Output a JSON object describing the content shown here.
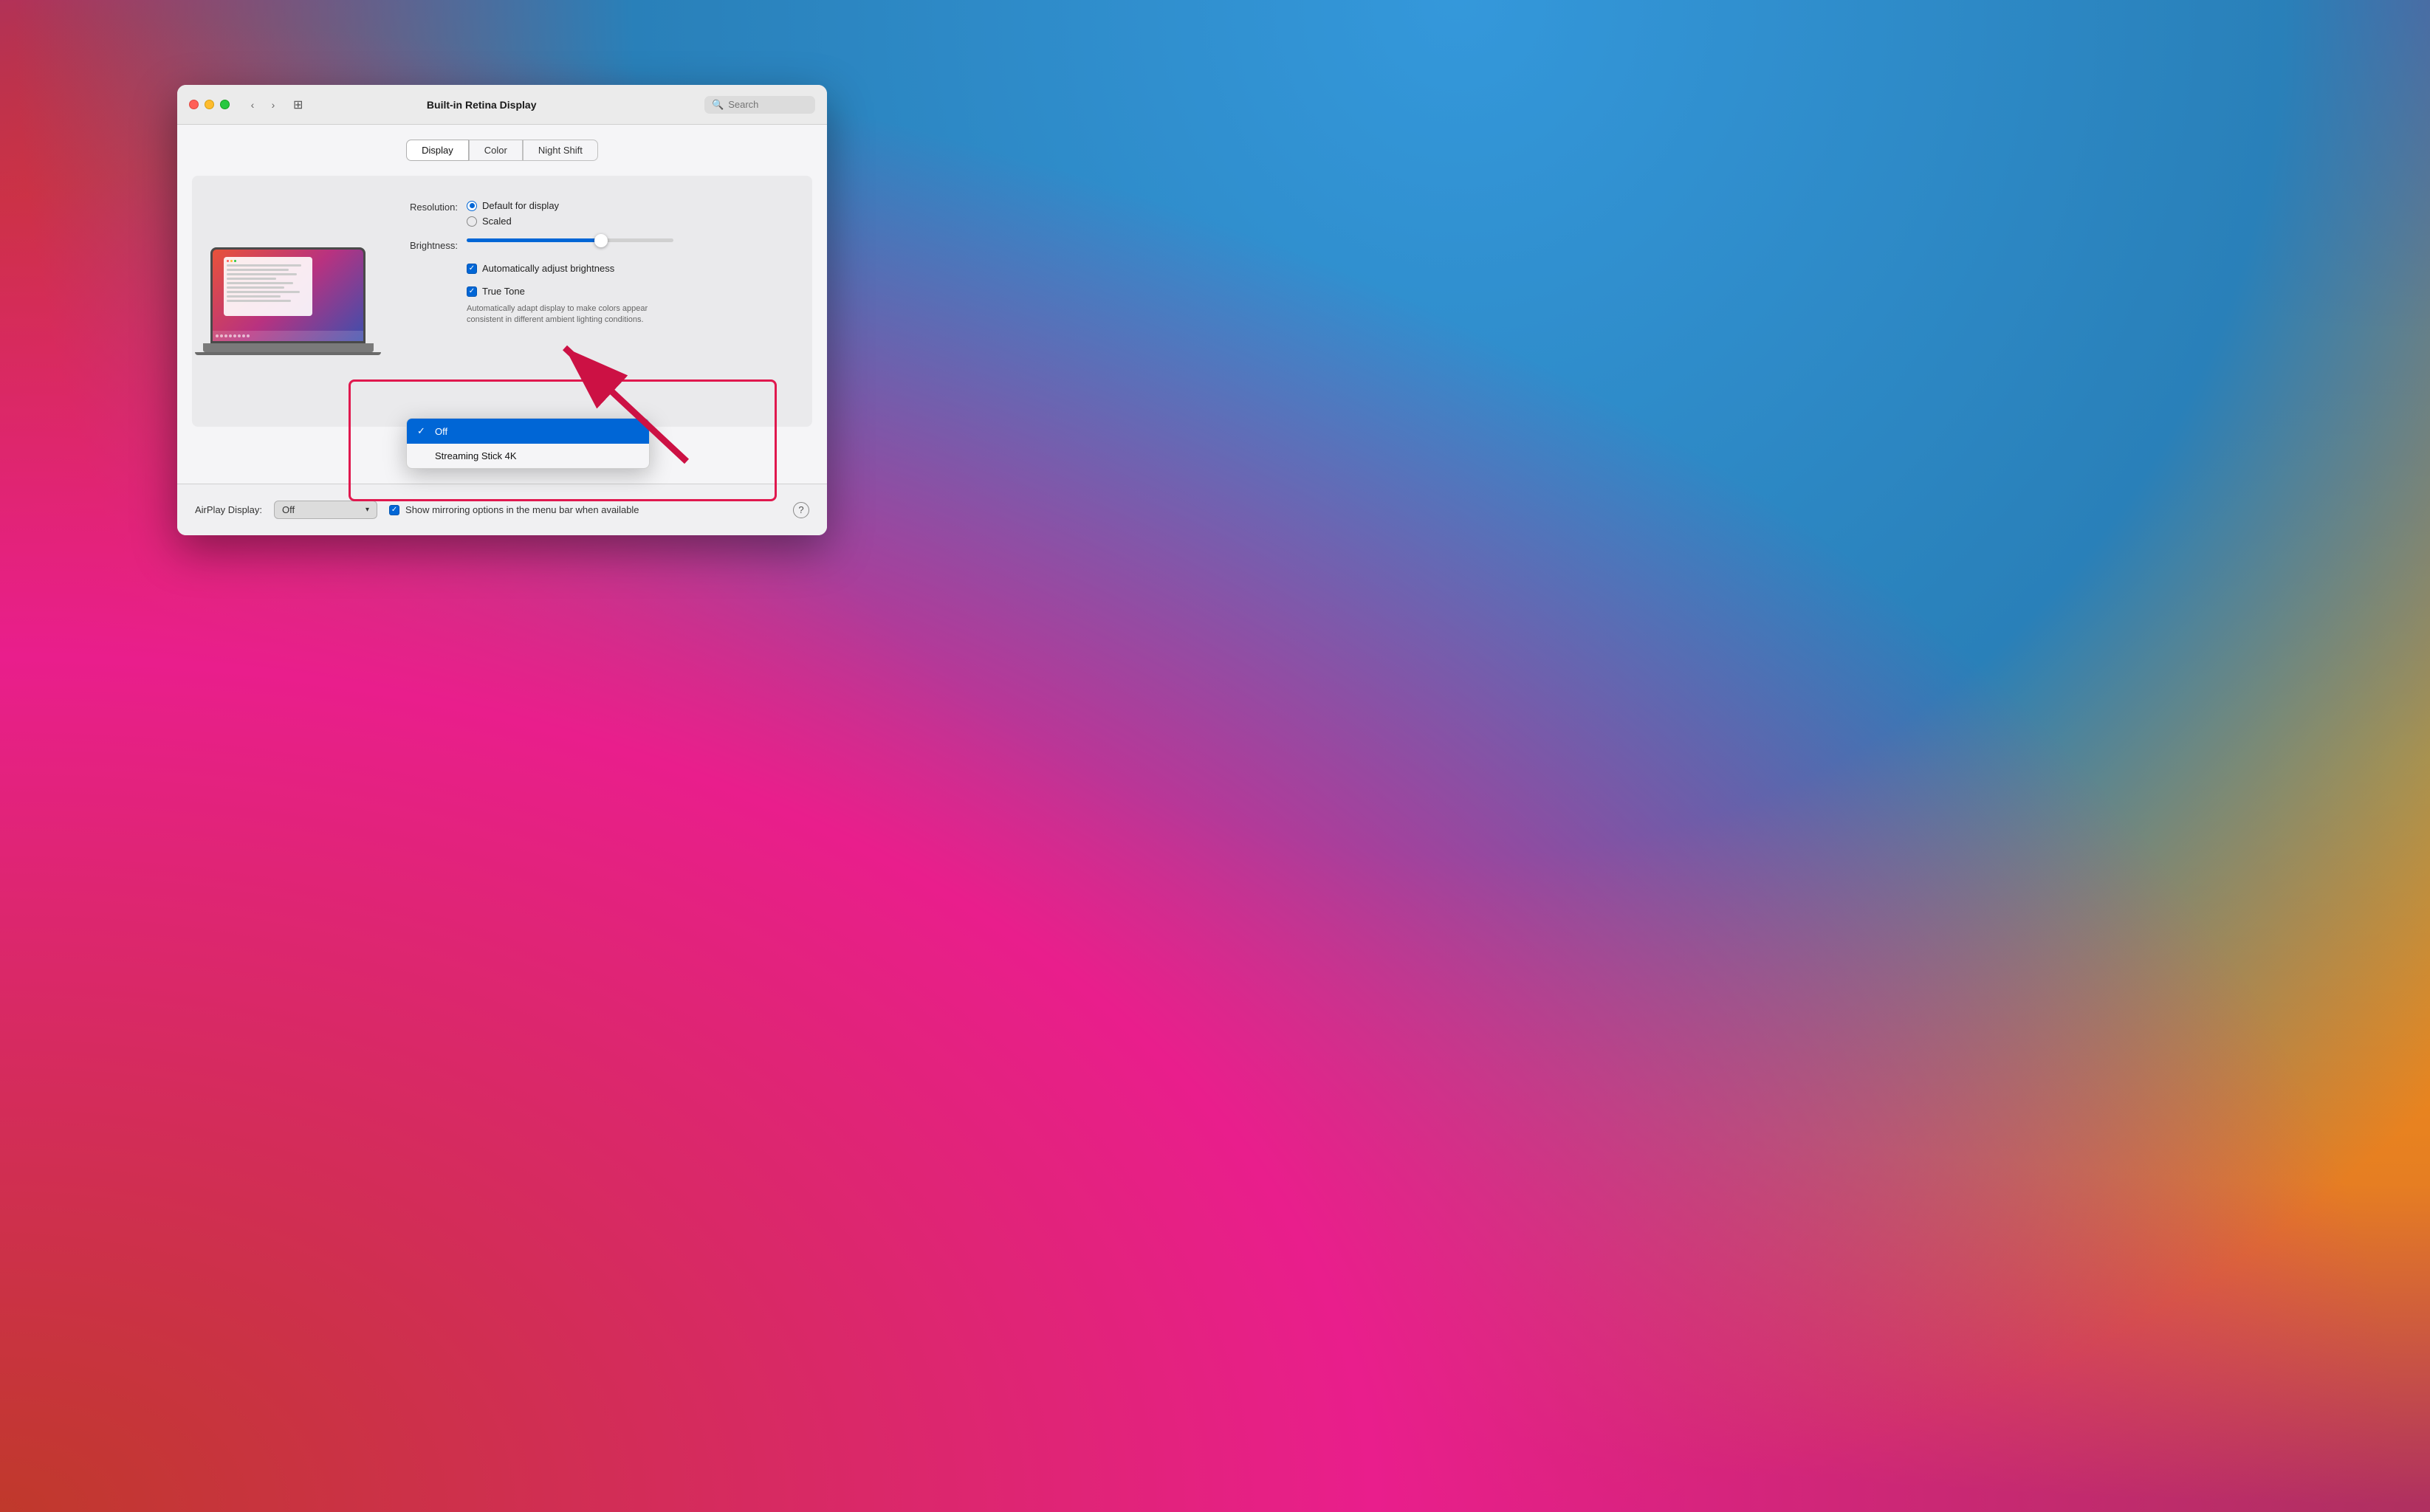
{
  "background": {
    "colors": [
      "#c0392b",
      "#e91e8c",
      "#3498db",
      "#f39c12"
    ]
  },
  "window": {
    "title": "Built-in Retina Display",
    "search_placeholder": "Search",
    "traffic_lights": {
      "close": "close",
      "minimize": "minimize",
      "maximize": "maximize"
    },
    "tabs": [
      {
        "label": "Display",
        "active": true
      },
      {
        "label": "Color",
        "active": false
      },
      {
        "label": "Night Shift",
        "active": false
      }
    ],
    "resolution": {
      "label": "Resolution:",
      "options": [
        {
          "label": "Default for display",
          "selected": true
        },
        {
          "label": "Scaled",
          "selected": false
        }
      ]
    },
    "brightness": {
      "label": "Brightness:",
      "value": 65
    },
    "auto_brightness": {
      "label": "Automatically adjust brightness",
      "checked": true
    },
    "true_tone": {
      "label": "True Tone",
      "checked": true,
      "description": "Automatically adapt display to make colors appear consistent in different ambient lighting conditions."
    },
    "airplay": {
      "label": "AirPlay Display:",
      "current_value": "Off",
      "options": [
        {
          "label": "Off",
          "selected": true
        },
        {
          "label": "Streaming Stick 4K",
          "selected": false
        }
      ]
    },
    "show_mirroring": {
      "label": "Show mirroring options in the menu bar when available",
      "checked": true
    }
  }
}
